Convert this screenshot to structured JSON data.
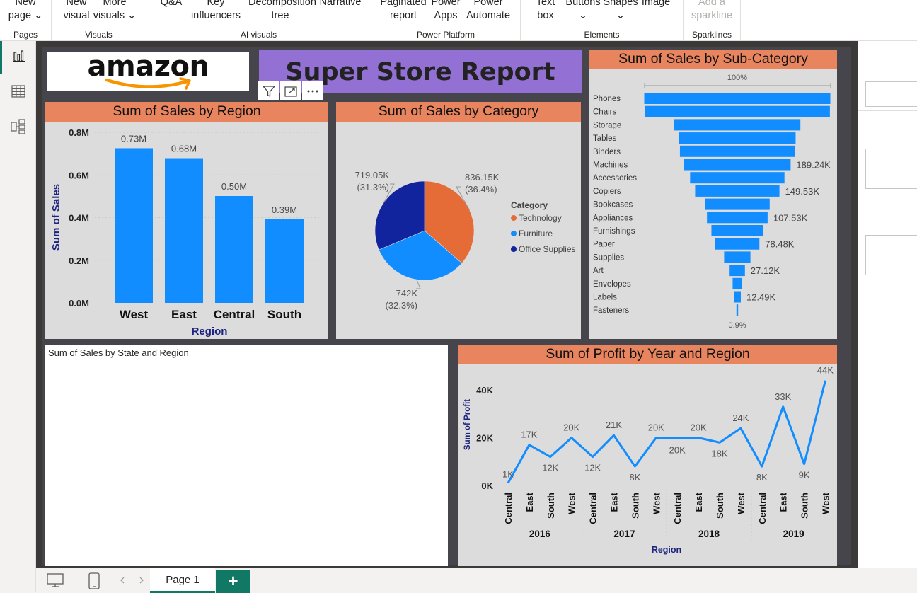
{
  "ribbon": {
    "groups": [
      {
        "label": "Pages",
        "buttons": [
          {
            "line1": "New",
            "line2": "page ⌄"
          }
        ]
      },
      {
        "label": "Visuals",
        "buttons": [
          {
            "line1": "New",
            "line2": "visual"
          },
          {
            "line1": "More",
            "line2": "visuals ⌄"
          }
        ]
      },
      {
        "label": "AI visuals",
        "buttons": [
          {
            "line1": "Q&A",
            "line2": ""
          },
          {
            "line1": "Key",
            "line2": "influencers"
          },
          {
            "line1": "Decomposition",
            "line2": "tree"
          },
          {
            "line1": "Narrative",
            "line2": ""
          }
        ]
      },
      {
        "label": "Power Platform",
        "buttons": [
          {
            "line1": "Paginated",
            "line2": "report"
          },
          {
            "line1": "Power",
            "line2": "Apps"
          },
          {
            "line1": "Power",
            "line2": "Automate"
          }
        ]
      },
      {
        "label": "Elements",
        "buttons": [
          {
            "line1": "Text",
            "line2": "box"
          },
          {
            "line1": "Buttons",
            "line2": "⌄"
          },
          {
            "line1": "Shapes",
            "line2": "⌄"
          },
          {
            "line1": "Image",
            "line2": ""
          }
        ]
      },
      {
        "label": "Sparklines",
        "buttons": [
          {
            "line1": "Add a",
            "line2": "sparkline"
          }
        ]
      }
    ]
  },
  "rail": {
    "items": [
      {
        "icon": "report-view-icon",
        "active": true
      },
      {
        "icon": "table-view-icon",
        "active": false
      },
      {
        "icon": "model-view-icon",
        "active": false
      }
    ]
  },
  "logo": {
    "text": "amazon"
  },
  "report_title": "Super Store Report",
  "visual_header_icons": [
    "filter-icon",
    "focus-mode-icon",
    "more-options-icon"
  ],
  "region_chart": {
    "title": "Sum of Sales by Region",
    "ylabel": "Sum of Sales",
    "xlabel": "Region",
    "yticks": [
      "0.0M",
      "0.2M",
      "0.4M",
      "0.6M",
      "0.8M"
    ]
  },
  "category_chart": {
    "title": "Sum of Sales by Category",
    "legend_title": "Category"
  },
  "subcat_chart": {
    "title": "Sum of Sales by Sub-Category",
    "top_pct": "100%",
    "bottom_pct": "0.9%"
  },
  "state_map": {
    "title": "Sum of Sales by State and Region"
  },
  "profit_chart": {
    "title": "Sum of Profit by Year and Region",
    "ylabel": "Sum of Profit",
    "xlabel": "Region",
    "yticks": [
      "0K",
      "20K",
      "40K"
    ]
  },
  "bottom": {
    "page_tab": "Page 1",
    "add_page": "+"
  },
  "colors": {
    "accent_blue": "#118dff",
    "title_bar": "#e8855f",
    "title_banner": "#9370d3",
    "tech_orange": "#e66c37",
    "furniture_blue": "#118dff",
    "office_navy": "#12239e",
    "axis_navy": "#1c2480"
  },
  "chart_data": [
    {
      "type": "bar",
      "title": "Sum of Sales by Region",
      "xlabel": "Region",
      "ylabel": "Sum of Sales",
      "categories": [
        "West",
        "East",
        "Central",
        "South"
      ],
      "values": [
        725457.82,
        678781.24,
        501239.89,
        391721.91
      ],
      "labels": [
        "0.73M",
        "0.68M",
        "0.50M",
        "0.39M"
      ],
      "ylim": [
        0,
        800000
      ],
      "grid": true
    },
    {
      "type": "pie",
      "title": "Sum of Sales by Category",
      "legend_title": "Category",
      "legend_position": "right",
      "slices": [
        {
          "name": "Technology",
          "value": 836154.03,
          "label": "836.15K",
          "pct": "(36.4%)"
        },
        {
          "name": "Furniture",
          "value": 741999.8,
          "label": "742K",
          "pct": "(32.3%)"
        },
        {
          "name": "Office Supplies",
          "value": 719047.03,
          "label": "719.05K",
          "pct": "(31.3%)"
        }
      ]
    },
    {
      "type": "bar",
      "title": "Sum of Sales by Sub-Category",
      "categories": [
        "Phones",
        "Chairs",
        "Storage",
        "Tables",
        "Binders",
        "Machines",
        "Accessories",
        "Copiers",
        "Bookcases",
        "Appliances",
        "Furnishings",
        "Paper",
        "Supplies",
        "Art",
        "Envelopes",
        "Labels",
        "Fasteners"
      ],
      "values": [
        330007,
        328449,
        223844,
        206966,
        203413,
        189239,
        167380,
        149528,
        114880,
        107532,
        91705,
        78479,
        46674,
        27119,
        16476,
        12486,
        3024
      ],
      "labels": [
        "",
        "",
        "",
        "",
        "",
        "189.24K",
        "",
        "149.53K",
        "",
        "107.53K",
        "",
        "78.48K",
        "",
        "27.12K",
        "",
        "12.49K",
        ""
      ]
    },
    {
      "type": "line",
      "title": "Sum of Profit by Year and Region",
      "xlabel": "Region",
      "ylabel": "Sum of Profit",
      "groups": [
        "2016",
        "2017",
        "2018",
        "2019"
      ],
      "categories": [
        "Central",
        "East",
        "South",
        "West"
      ],
      "values": [
        1000,
        17000,
        12000,
        20000,
        12000,
        21000,
        8000,
        20000,
        20000,
        20000,
        18000,
        24000,
        8000,
        33000,
        9000,
        44000
      ],
      "labels": [
        "1K",
        "17K",
        "12K",
        "20K",
        "12K",
        "21K",
        "8K",
        "20K",
        "20K",
        "20K",
        "18K",
        "24K",
        "8K",
        "33K",
        "9K",
        "44K"
      ],
      "ylim": [
        0,
        46000
      ]
    }
  ]
}
